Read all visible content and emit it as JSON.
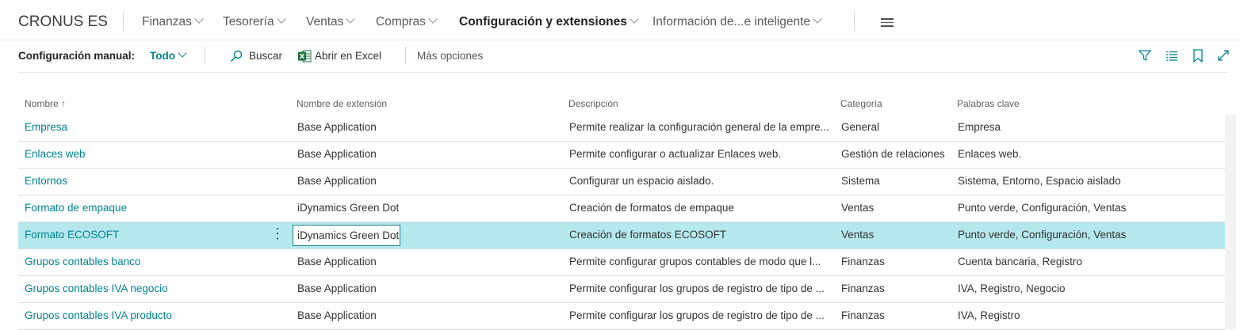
{
  "header": {
    "company": "CRONUS ES",
    "nav": [
      {
        "label": "Finanzas"
      },
      {
        "label": "Tesorería"
      },
      {
        "label": "Ventas"
      },
      {
        "label": "Compras"
      },
      {
        "label": "Configuración y extensiones",
        "active": true
      },
      {
        "label": "Información de...e inteligente"
      }
    ],
    "menu_icon": "hamburger-icon"
  },
  "actionbar": {
    "label": "Configuración manual:",
    "filter": "Todo",
    "search": "Buscar",
    "excel": "Abrir en Excel",
    "more": "Más opciones",
    "icons": [
      "filter-icon",
      "list-view-icon",
      "bookmark-icon",
      "expand-icon"
    ]
  },
  "table": {
    "columns": [
      "Nombre",
      "Nombre de extensión",
      "Descripción",
      "Categoría",
      "Palabras clave"
    ],
    "sort_indicator": "↑",
    "selected_row": 4,
    "rows": [
      {
        "name": "Empresa",
        "ext": "Base Application",
        "desc": "Permite realizar la configuración general de la empre...",
        "cat": "General",
        "kw": "Empresa"
      },
      {
        "name": "Enlaces web",
        "ext": "Base Application",
        "desc": "Permite configurar o actualizar Enlaces web.",
        "cat": "Gestión de relaciones",
        "kw": "Enlaces web."
      },
      {
        "name": "Entornos",
        "ext": "Base Application",
        "desc": "Configurar un espacio aislado.",
        "cat": "Sistema",
        "kw": "Sistema, Entorno, Espacio aislado"
      },
      {
        "name": "Formato de empaque",
        "ext": "iDynamics Green Dot",
        "desc": "Creación de formatos de empaque",
        "cat": "Ventas",
        "kw": "Punto verde, Configuración, Ventas"
      },
      {
        "name": "Formato ECOSOFT",
        "ext": "iDynamics Green Dot",
        "desc": "Creación de formatos ECOSOFT",
        "cat": "Ventas",
        "kw": "Punto verde, Configuración, Ventas"
      },
      {
        "name": "Grupos contables banco",
        "ext": "Base Application",
        "desc": "Permite configurar grupos contables de modo que l...",
        "cat": "Finanzas",
        "kw": "Cuenta bancaria, Registro"
      },
      {
        "name": "Grupos contables IVA negocio",
        "ext": "Base Application",
        "desc": "Permite configurar los grupos de registro de tipo de ...",
        "cat": "Finanzas",
        "kw": "IVA, Registro, Negocio"
      },
      {
        "name": "Grupos contables IVA producto",
        "ext": "Base Application",
        "desc": "Permite configurar los grupos de registro de tipo de ...",
        "cat": "Finanzas",
        "kw": "IVA, Registro"
      }
    ]
  },
  "colors": {
    "accent": "#00838f",
    "selected_row": "#b4e8ec",
    "excel_green": "#1d6f42"
  }
}
